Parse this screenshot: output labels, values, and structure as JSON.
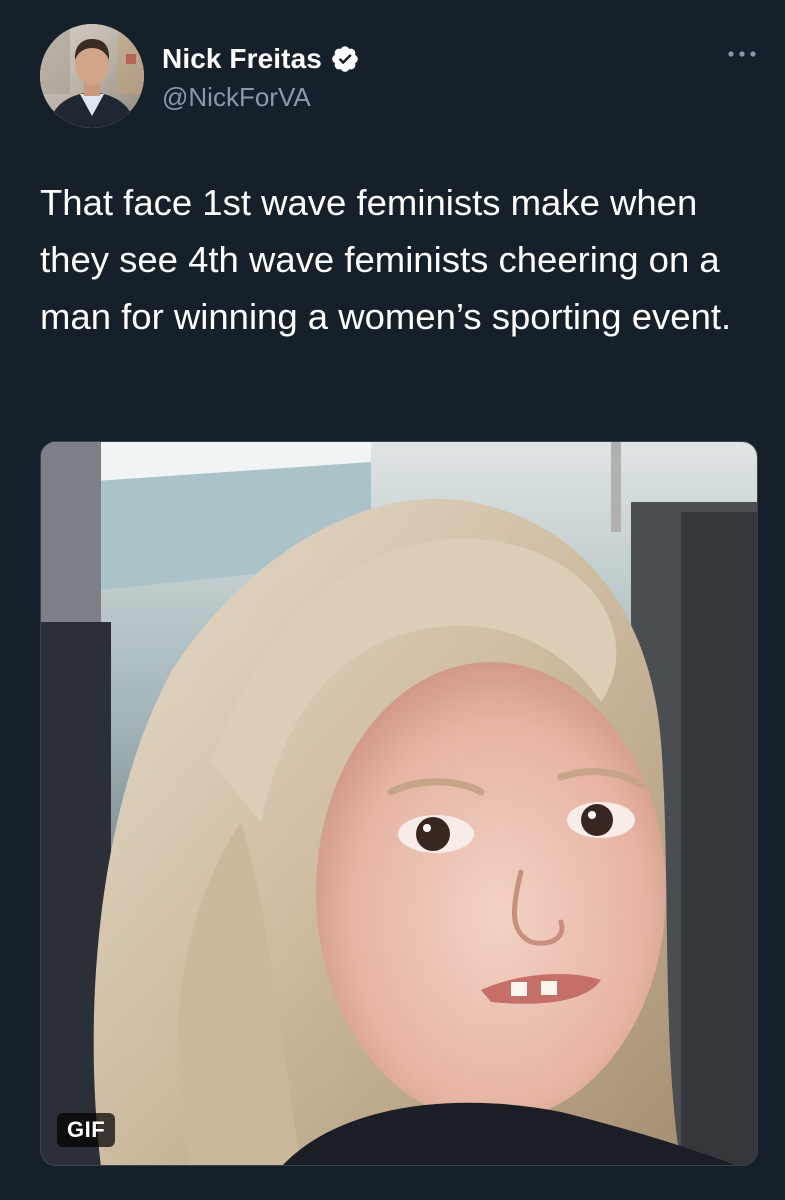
{
  "tweet": {
    "author": {
      "name": "Nick Freitas",
      "handle": "@NickForVA",
      "verified": true
    },
    "text": "That face 1st wave feminists make when they see 4th wave feminists cheering on a man for winning a women’s sporting event.",
    "media": {
      "type": "gif",
      "badge": "GIF"
    }
  },
  "colors": {
    "background": "#15202b",
    "text_primary": "#ffffff",
    "text_secondary": "#8b98a5",
    "verified_badge": "#ffffff"
  },
  "icons": {
    "verified": "verified-badge-icon",
    "more": "more-options-icon"
  }
}
